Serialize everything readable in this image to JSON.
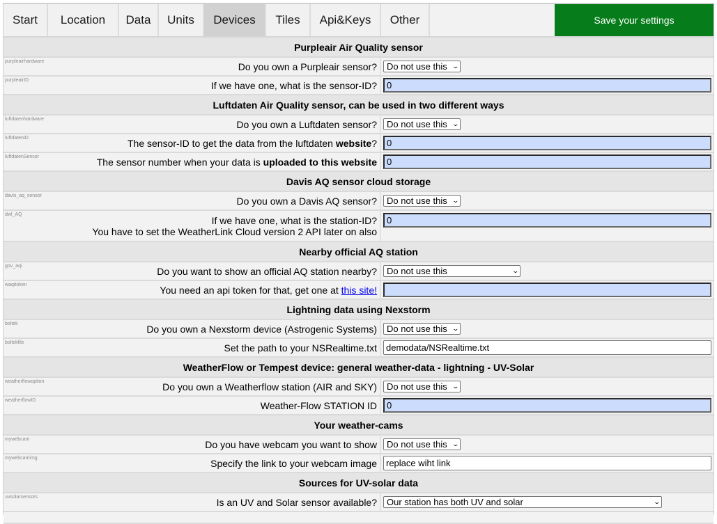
{
  "tabs": [
    {
      "label": "Start",
      "active": false
    },
    {
      "label": "Location",
      "active": false
    },
    {
      "label": "Data",
      "active": false
    },
    {
      "label": "Units",
      "active": false
    },
    {
      "label": "Devices",
      "active": true
    },
    {
      "label": "Tiles",
      "active": false
    },
    {
      "label": "Api&Keys",
      "active": false
    },
    {
      "label": "Other",
      "active": false
    }
  ],
  "save_button": "Save your settings",
  "sections": {
    "purpleair": {
      "title": "Purpleair Air Quality sensor",
      "hardware": {
        "key": "purpleairhardware",
        "question": "Do you own a Purpleair sensor?",
        "value": "Do not use this"
      },
      "id": {
        "key": "purpleairID",
        "question": "If we have one, what is the sensor-ID?",
        "value": "0"
      }
    },
    "luftdaten": {
      "title": "Luftdaten Air Quality sensor, can be used in two different ways",
      "hardware": {
        "key": "luftdatenhardware",
        "question": "Do you own a Luftdaten sensor?",
        "value": "Do not use this"
      },
      "id": {
        "key": "luftdatenID",
        "question_prefix": "The sensor-ID to get the data from the luftdaten ",
        "question_bold": "website",
        "question_suffix": "?",
        "value": "0"
      },
      "sensor": {
        "key": "luftdatenSensor",
        "question_prefix": "The sensor number when your data is ",
        "question_bold": "uploaded to this website",
        "value": "0"
      }
    },
    "davis": {
      "title": "Davis AQ sensor cloud storage",
      "sensor": {
        "key": "davis_aq_sensor",
        "question": "Do you own a Davis AQ sensor?",
        "value": "Do not use this"
      },
      "station": {
        "key": "dwl_AQ",
        "question_line1": "If we have one, what is the station-ID?",
        "question_line2": "You have to set the WeatherLink Cloud version 2 API later on also",
        "value": "0"
      }
    },
    "official": {
      "title": "Nearby official AQ station",
      "gov": {
        "key": "gov_aqi",
        "question": "Do you want to show an official AQ station nearby?",
        "value": "Do not use this"
      },
      "token": {
        "key": "waqitoken",
        "question": "You need an api token for that, get one at ",
        "link_text": "this site!",
        "value": ""
      }
    },
    "nexstorm": {
      "title": "Lightning data using Nexstorm",
      "device": {
        "key": "boltek",
        "question": "Do you own a Nexstorm device (Astrogenic Systems)",
        "value": "Do not use this"
      },
      "file": {
        "key": "boltekfile",
        "question": "Set the path to your NSRealtime.txt",
        "value": "demodata/NSRealtime.txt"
      }
    },
    "weatherflow": {
      "title": "WeatherFlow or Tempest device: general weather-data - lightning - UV-Solar",
      "option": {
        "key": "weatherflowoption",
        "question": "Do you own a Weatherflow station (AIR and SKY)",
        "value": "Do not use this"
      },
      "id": {
        "key": "weatherflowID",
        "question": "Weather-Flow STATION ID",
        "value": "0"
      }
    },
    "webcam": {
      "title": "Your weather-cams",
      "cam": {
        "key": "mywebcam",
        "question": "Do you have webcam you want to show",
        "value": "Do not use this"
      },
      "img": {
        "key": "mywebcamimg",
        "question": "Specify the link to your webcam image",
        "value": "replace wiht link"
      }
    },
    "uvsolar": {
      "title": "Sources for UV-solar data",
      "sensors": {
        "key": "uvsolarsensors",
        "question": "Is an UV and Solar sensor available?",
        "value": "Our station has both UV and solar"
      }
    }
  },
  "colors": {
    "save_button": "#067d1a",
    "active_tab": "#d1d1d1",
    "input_highlight": "#ccdcfc",
    "section_header": "#e5e5e5"
  }
}
